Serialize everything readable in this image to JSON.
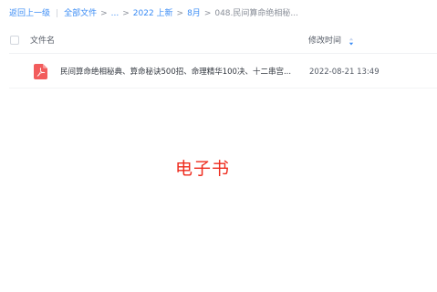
{
  "breadcrumb": {
    "back": "返回上一级",
    "all_files": "全部文件",
    "ellipsis": "...",
    "folder_2022": "2022 上新",
    "folder_aug": "8月",
    "current": "048.民间算命绝相秘..."
  },
  "list": {
    "column_name": "文件名",
    "column_time": "修改时间"
  },
  "files": [
    {
      "icon": "pdf-icon",
      "name": "民间算命绝相秘典、算命秘诀500招、命理精华100决、十二串宫...",
      "modified": "2022-08-21 13:49"
    }
  ],
  "overlay": {
    "text": "电子书",
    "color": "#ee2b1d"
  },
  "colors": {
    "link": "#3b8cf5",
    "pdf": "#f25c5c"
  }
}
